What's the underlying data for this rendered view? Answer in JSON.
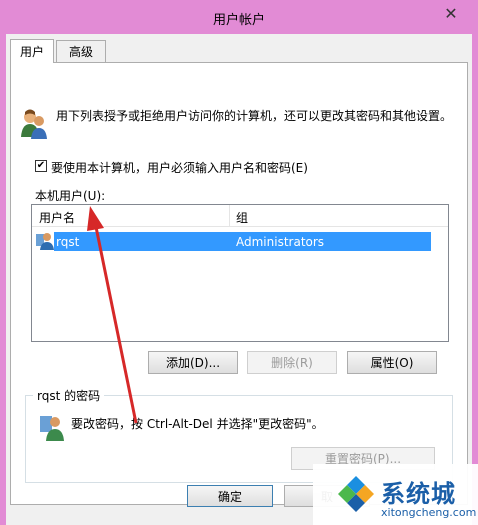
{
  "window": {
    "title": "用户帐户",
    "close_glyph": "✕"
  },
  "tabs": [
    {
      "label": "用户",
      "active": true
    },
    {
      "label": "高级",
      "active": false
    }
  ],
  "description": "用下列表授予或拒绝用户访问你的计算机，还可以更改其密码和其他设置。",
  "require_password": {
    "label": "要使用本计算机，用户必须输入用户名和密码(E)",
    "checked": true,
    "check_glyph": "✔"
  },
  "local_users": {
    "label": "本机用户(U):",
    "columns": {
      "name": "用户名",
      "group": "组"
    },
    "rows": [
      {
        "name": "rqst",
        "group": "Administrators",
        "selected": true
      }
    ]
  },
  "buttons": {
    "add": "添加(D)...",
    "remove": "删除(R)",
    "properties": "属性(O)"
  },
  "password_section": {
    "title": "rqst 的密码",
    "text": "要改密码，按 Ctrl-Alt-Del 并选择\"更改密码\"。",
    "reset_button": "重置密码(P)..."
  },
  "footer": {
    "ok": "确定",
    "cancel": "取"
  },
  "watermark": {
    "name": "系统城",
    "url": "xitongcheng.com"
  },
  "colors": {
    "frame": "#e28bd5",
    "selection": "#3399ff",
    "annotation_arrow": "#d62828",
    "brand": "#1b5fa8"
  }
}
